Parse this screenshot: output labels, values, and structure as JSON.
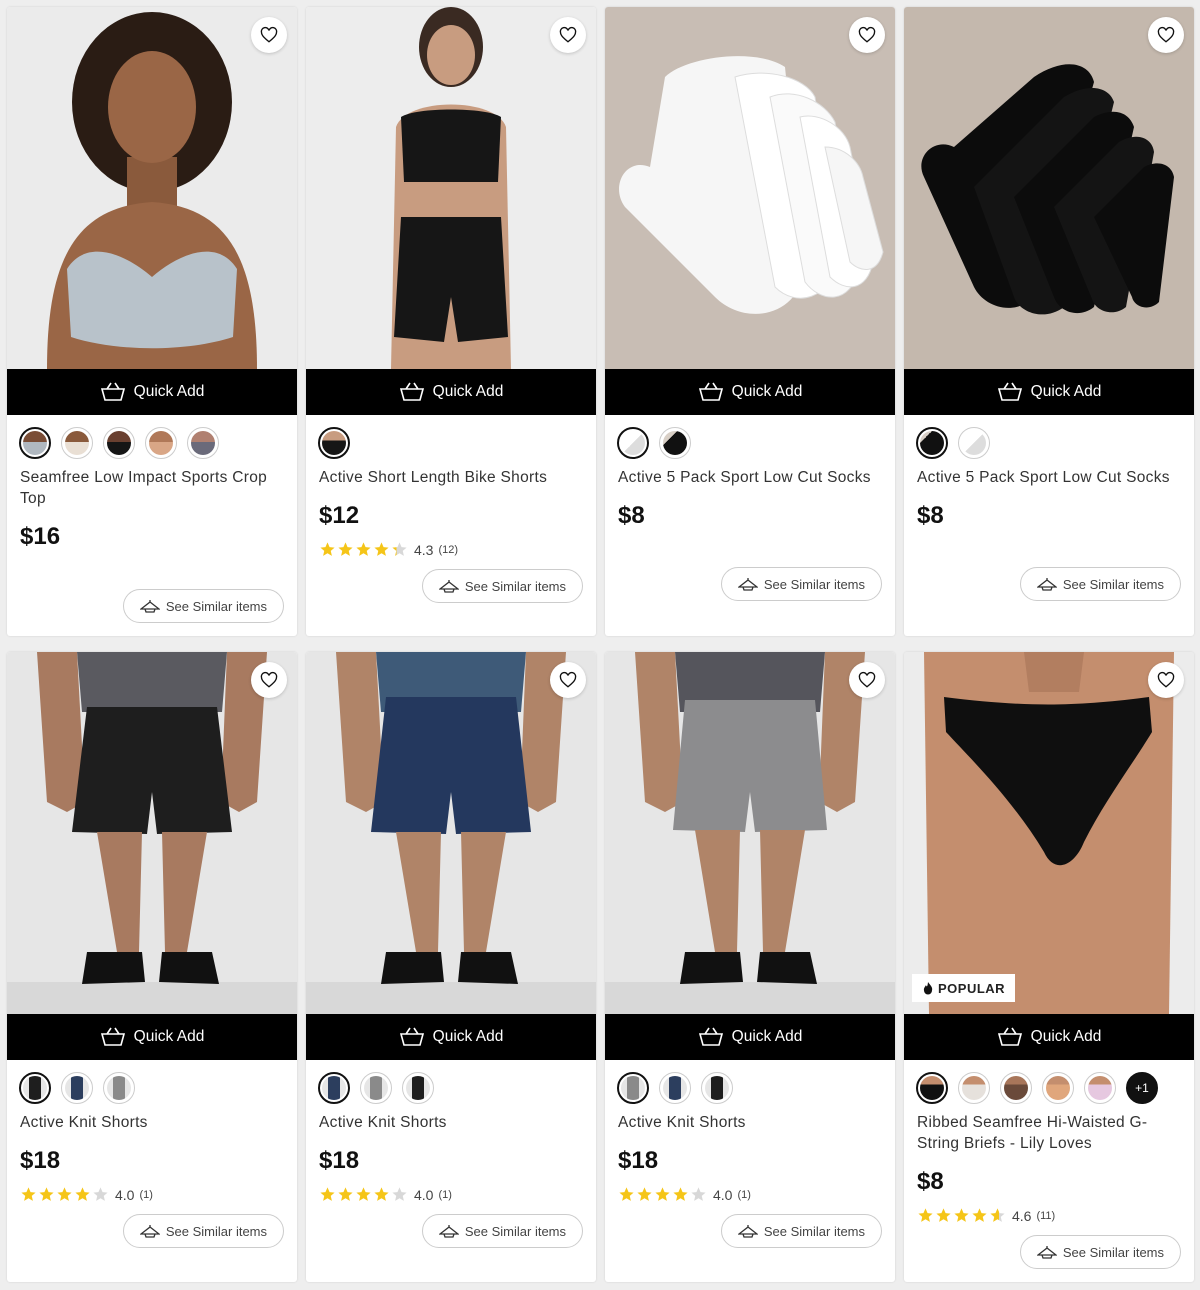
{
  "ui": {
    "quick_add": "Quick Add",
    "see_similar": "See Similar items",
    "popular": "POPULAR"
  },
  "products": [
    {
      "name": "Seamfree Low Impact Sports Crop Top",
      "price": "$16",
      "swatches": 5,
      "image": "grey-crop-top"
    },
    {
      "name": "Active Short Length Bike Shorts",
      "price": "$12",
      "rating": "4.3",
      "rating_value": 4.3,
      "reviews": "(12)",
      "swatches": 1,
      "image": "black-bike-shorts"
    },
    {
      "name": "Active 5 Pack Sport Low Cut Socks",
      "price": "$8",
      "swatches": 2,
      "image": "white-socks"
    },
    {
      "name": "Active 5 Pack Sport Low Cut Socks",
      "price": "$8",
      "swatches": 2,
      "image": "black-socks"
    },
    {
      "name": "Active Knit Shorts",
      "price": "$18",
      "rating": "4.0",
      "rating_value": 4.0,
      "reviews": "(1)",
      "swatches": 3,
      "image": "black-knit-shorts"
    },
    {
      "name": "Active Knit Shorts",
      "price": "$18",
      "rating": "4.0",
      "rating_value": 4.0,
      "reviews": "(1)",
      "swatches": 3,
      "image": "navy-knit-shorts"
    },
    {
      "name": "Active Knit Shorts",
      "price": "$18",
      "rating": "4.0",
      "rating_value": 4.0,
      "reviews": "(1)",
      "swatches": 3,
      "image": "grey-knit-shorts"
    },
    {
      "name": "Ribbed Seamfree Hi-Waisted G-String Briefs - Lily Loves",
      "price": "$8",
      "rating": "4.6",
      "rating_value": 4.6,
      "reviews": "(11)",
      "swatches": 5,
      "more_swatches": "+1",
      "popular": true,
      "image": "black-briefs"
    }
  ],
  "colors": {
    "star": "#f5c518",
    "quick_add_bg": "#000000"
  }
}
